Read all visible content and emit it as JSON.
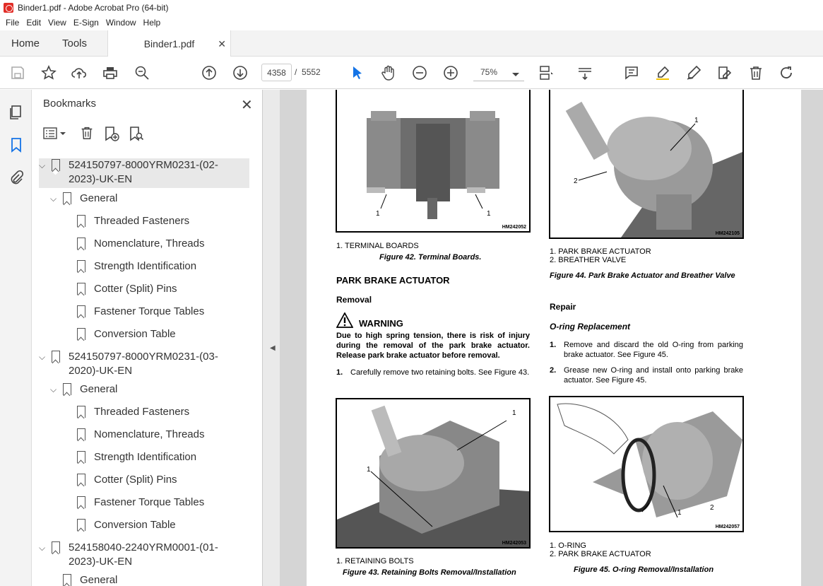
{
  "window": {
    "title": "Binder1.pdf - Adobe Acrobat Pro (64-bit)"
  },
  "menu": [
    "File",
    "Edit",
    "View",
    "E-Sign",
    "Window",
    "Help"
  ],
  "tabs": {
    "home": "Home",
    "tools": "Tools",
    "file": "Binder1.pdf"
  },
  "toolbar": {
    "page_current": "4358",
    "page_sep": "/",
    "page_total": "5552",
    "zoom": "75%"
  },
  "bookmarks": {
    "title": "Bookmarks",
    "items": [
      {
        "label": "524150797-8000YRM0231-(02-2023)-UK-EN",
        "level": 0
      },
      {
        "label": "General",
        "level": 1
      },
      {
        "label": "Threaded Fasteners",
        "level": 2
      },
      {
        "label": "Nomenclature, Threads",
        "level": 2
      },
      {
        "label": "Strength Identification",
        "level": 2
      },
      {
        "label": "Cotter (Split) Pins",
        "level": 2
      },
      {
        "label": "Fastener Torque Tables",
        "level": 2
      },
      {
        "label": "Conversion Table",
        "level": 2
      },
      {
        "label": "524150797-8000YRM0231-(03-2020)-UK-EN",
        "level": 0
      },
      {
        "label": "General",
        "level": 1
      },
      {
        "label": "Threaded Fasteners",
        "level": 2
      },
      {
        "label": "Nomenclature, Threads",
        "level": 2
      },
      {
        "label": "Strength Identification",
        "level": 2
      },
      {
        "label": "Cotter (Split) Pins",
        "level": 2
      },
      {
        "label": "Fastener Torque Tables",
        "level": 2
      },
      {
        "label": "Conversion Table",
        "level": 2
      },
      {
        "label": "524158040-2240YRM0001-(01-2023)-UK-EN",
        "level": 0
      },
      {
        "label": "General",
        "level": 1
      }
    ]
  },
  "doc": {
    "fig42": {
      "code": "HM242052",
      "callouts": [
        "1",
        "1"
      ],
      "legend": "1.   TERMINAL BOARDS",
      "caption": "Figure 42. Terminal Boards."
    },
    "section_title": "PARK BRAKE ACTUATOR",
    "removal_title": "Removal",
    "warning_title": "WARNING",
    "warning_text": "Due to high spring tension, there is risk of injury during the removal of the park brake actuator. Release park brake actuator before removal.",
    "removal_step1_num": "1.",
    "removal_step1": "Carefully remove two retaining bolts. See Figure 43.",
    "fig43": {
      "code": "HM242053",
      "callouts": [
        "1",
        "1"
      ],
      "legend": "1.   RETAINING BOLTS",
      "caption": "Figure 43. Retaining Bolts Removal/Installation"
    },
    "fig44": {
      "code": "HM242105",
      "callouts": [
        "1",
        "2"
      ],
      "legend1": "1.   PARK BRAKE ACTUATOR",
      "legend2": "2.   BREATHER VALVE",
      "caption": "Figure 44. Park Brake Actuator and Breather Valve"
    },
    "repair_title": "Repair",
    "oring_title": "O-ring Replacement",
    "repair_step1_num": "1.",
    "repair_step1": "Remove and discard the old O-ring from parking brake actuator. See Figure 45.",
    "repair_step2_num": "2.",
    "repair_step2": "Grease new O-ring and install onto parking brake actuator. See Figure 45.",
    "fig45": {
      "code": "HM242057",
      "callouts": [
        "1",
        "2"
      ],
      "legend1": "1.   O-RING",
      "legend2": "2.   PARK BRAKE ACTUATOR",
      "caption": "Figure 45. O-ring Removal/Installation"
    }
  }
}
